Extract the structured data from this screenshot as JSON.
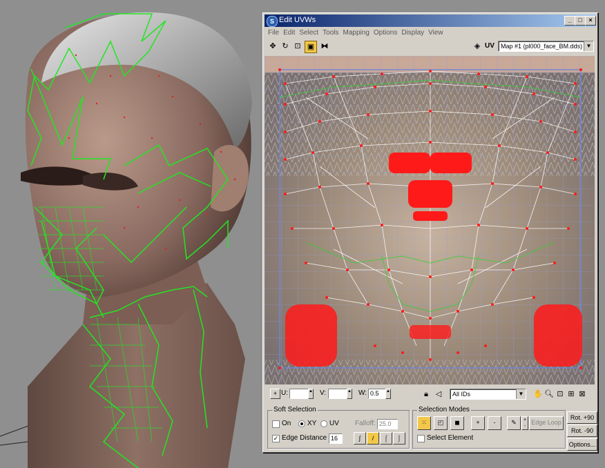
{
  "window": {
    "title": "Edit UVWs",
    "title_buttons": [
      "_",
      "□",
      "×"
    ]
  },
  "menu": [
    "File",
    "Edit",
    "Select",
    "Tools",
    "Mapping",
    "Options",
    "Display",
    "View"
  ],
  "toolbar": {
    "uv_label": "UV",
    "map_selector": "Map #1 (pl000_face_BM.dds)"
  },
  "bottombar": {
    "u_label": "U:",
    "v_label": "V:",
    "w_label": "W:",
    "w_value": "0.5",
    "ids_selector": "All IDs"
  },
  "soft_selection": {
    "title": "Soft Selection",
    "on_label": "On",
    "xy_label": "XY",
    "uv_label": "UV",
    "falloff_label": "Falloff:",
    "falloff_value": "25.0",
    "edge_distance_label": "Edge Distance",
    "edge_distance_value": "16"
  },
  "selection_modes": {
    "title": "Selection Modes",
    "plus_label": "+",
    "minus_label": "-",
    "edge_loop_label": "Edge Loop",
    "select_element_label": "Select Element"
  },
  "rotate": {
    "plus90": "Rot. +90",
    "minus90": "Rot. -90",
    "options": "Options..."
  },
  "colors": {
    "mesh_wire": "#22e622",
    "uv_edges": "#ffffff",
    "uv_vertices": "#ff1a1a",
    "window_face": "#d4d0c8",
    "title_active": "#0a246a"
  }
}
